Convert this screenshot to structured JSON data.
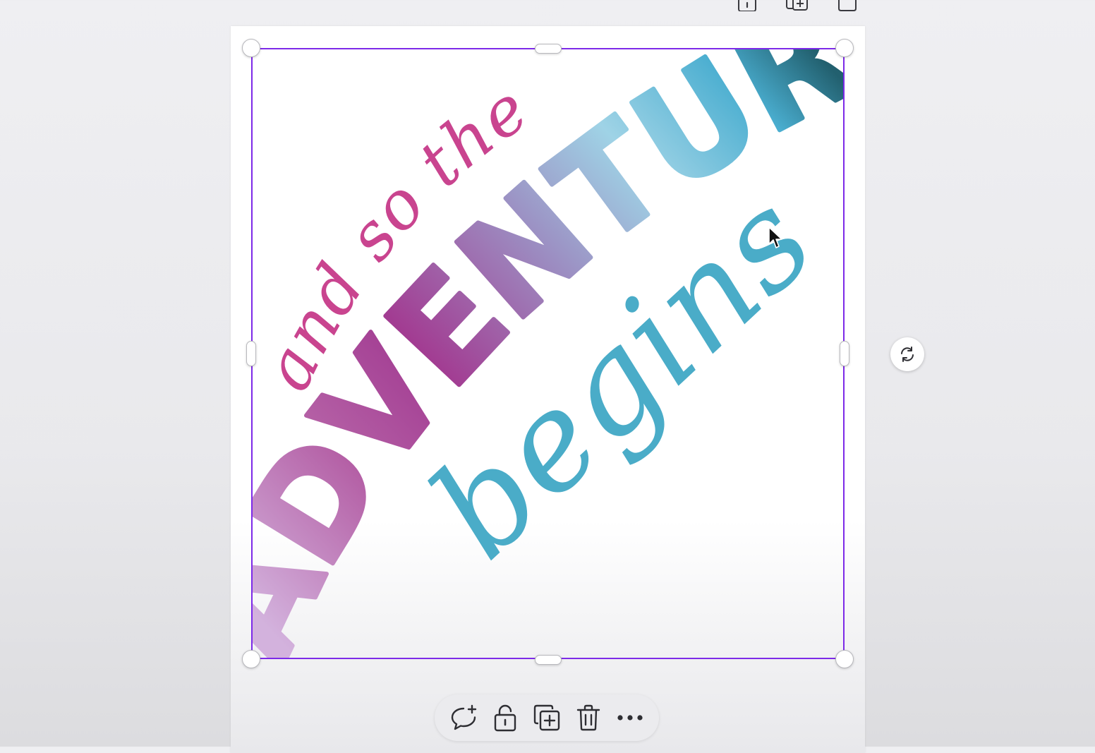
{
  "design_text": {
    "line1": "and so the",
    "line2": "ADVENTURE",
    "line3": "begins"
  },
  "colors": {
    "selection": "#7d2ae8",
    "line1": "#c9448f",
    "line3": "#4aacc8",
    "adventure_gradient": [
      "#c9a6d6",
      "#a34a98",
      "#9a8fc3",
      "#9fd2e6",
      "#4aaecf",
      "#2a6e82"
    ]
  },
  "top_actions": [
    "lock-page-icon",
    "duplicate-page-icon",
    "add-page-icon"
  ],
  "toolbar": {
    "items": [
      "add-comment-icon",
      "lock-icon",
      "duplicate-icon",
      "delete-icon",
      "more-icon"
    ]
  }
}
